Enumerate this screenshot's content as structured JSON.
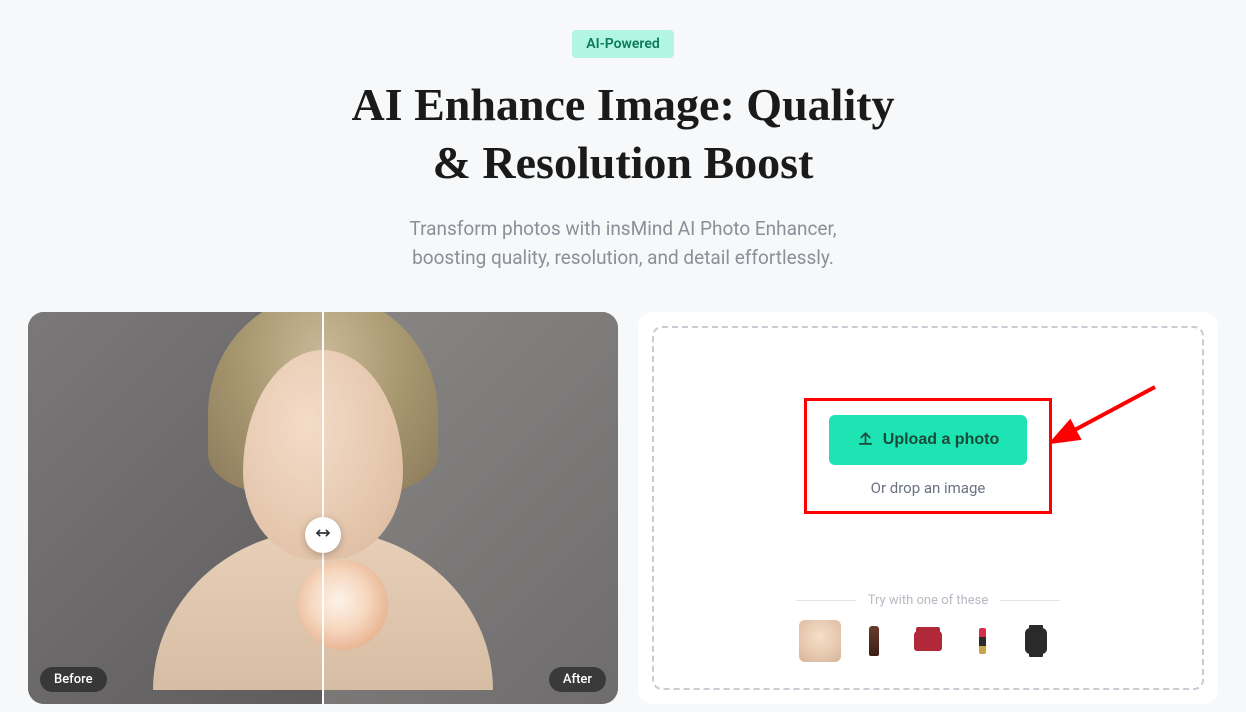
{
  "header": {
    "badge": "AI-Powered",
    "title_line1": "AI Enhance Image: Quality",
    "title_line2": "& Resolution Boost",
    "subtitle_line1": "Transform photos with insMind AI Photo Enhancer,",
    "subtitle_line2": "boosting quality, resolution, and detail effortlessly."
  },
  "comparison": {
    "before_label": "Before",
    "after_label": "After"
  },
  "upload": {
    "button_label": "Upload a photo",
    "drop_text": "Or drop an image",
    "samples_heading": "Try with one of these",
    "samples": [
      {
        "name": "face"
      },
      {
        "name": "bottle"
      },
      {
        "name": "bag"
      },
      {
        "name": "lipstick"
      },
      {
        "name": "watch"
      }
    ]
  }
}
